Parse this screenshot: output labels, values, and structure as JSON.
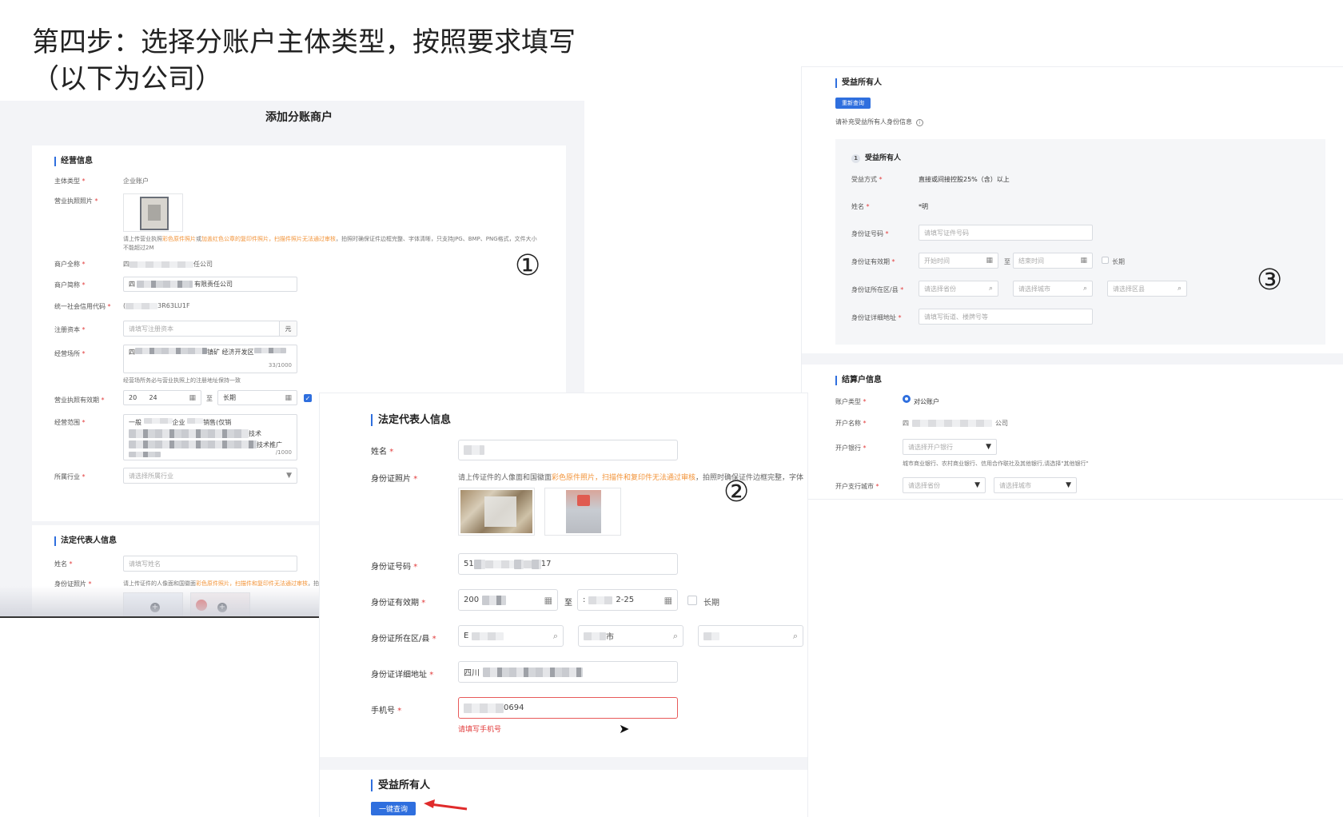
{
  "headline": {
    "line1": "第四步：选择分账户主体类型，按照要求填写",
    "line2": "（以下为公司）"
  },
  "panel1": {
    "title": "添加分账商户",
    "circle": "①",
    "business_section": "经营信息",
    "subject_type_label": "主体类型",
    "subject_type_value": "企业账户",
    "license_photo_label": "营业执照照片",
    "license_hint_a": "请上传营业执照",
    "license_hint_b": "彩色原件照片",
    "license_hint_c": "或",
    "license_hint_d": "加盖红色公章的复印件照片，扫描件照片无法通过审核",
    "license_hint_e": "，拍照时确保证件边框完整、字体清晰，只支持JPG、BMP、PNG格式，文件大小",
    "license_hint_f": "不能超过2M",
    "full_name_label": "商户全称",
    "full_name_a": "四",
    "full_name_b": "任公司",
    "short_name_label": "商户简称",
    "short_name_a": "四",
    "short_name_b": "有限责任公司",
    "credit_code_label": "统一社会信用代码",
    "credit_code_a": "(",
    "credit_code_b": "3R63LU1F",
    "capital_label": "注册资本",
    "capital_placeholder": "请填写注册资本",
    "capital_unit": "元",
    "place_label": "经营场所",
    "place_a": "四",
    "place_b": "镇矿",
    "place_c": "经济开发",
    "place_d": "区",
    "place_e": "",
    "place_count": "33/1000",
    "place_hint": "经营场所务必与营业执照上的注册地址保持一致",
    "validity_label": "营业执照有效期",
    "validity_start_a": "20",
    "validity_start_b": "24",
    "validity_to": "至",
    "validity_end": "长期",
    "scope_label": "经营范围",
    "scope_a": "一般",
    "scope_b": "企业",
    "scope_c": "销售(仅销",
    "scope_d": "技术",
    "scope_e": "技",
    "scope_f": "术推广",
    "scope_count": "/1000",
    "industry_label": "所属行业",
    "industry_placeholder": "请选择所属行业",
    "legal_section": "法定代表人信息",
    "name_label": "姓名",
    "name_placeholder": "请填写姓名",
    "id_photo_label": "身份证照片",
    "id_hint_a": "请上传证件的人像面和国徽面",
    "id_hint_b": "彩色原件照片",
    "id_hint_c": "，扫描件和复印件无法通过审核",
    "id_hint_d": "，拍"
  },
  "panel2": {
    "circle": "②",
    "section": "法定代表人信息",
    "name_label": "姓名",
    "id_photo_label": "身份证照片",
    "id_hint_a": "请上传证件的人像面和国徽面",
    "id_hint_b": "彩色原件照片",
    "id_hint_c": "，扫描件和复印件无法通过审核",
    "id_hint_d": "，拍照时确保证件边框完整，字体",
    "id_number_label": "身份证号码",
    "id_number_a": "51",
    "id_number_b": "17",
    "id_validity_label": "身份证有效期",
    "id_validity_start": "200",
    "id_validity_to": "至",
    "id_validity_end_a": ":",
    "id_validity_end_b": "2-25",
    "long_term": "长期",
    "id_region_label": "身份证所在区/县",
    "region_1": "E",
    "region_2": "市",
    "region_3": "",
    "id_address_label": "身份证详细地址",
    "id_address": "四川",
    "phone_label": "手机号",
    "phone_value": "0694",
    "phone_error": "请填写手机号",
    "beneficiary_section": "受益所有人",
    "one_click_button": "一键查询"
  },
  "panel3": {
    "circle": "③",
    "beneficiary_section": "受益所有人",
    "requery_button": "重新查询",
    "supplement_hint": "请补充受益所有人身份信息",
    "step_number": "1",
    "step_title": "受益所有人",
    "benefit_mode_label": "受益方式",
    "benefit_mode_value": "直接或间接控股25%（含）以上",
    "name_label": "姓名",
    "name_value": "*明",
    "id_number_label": "身份证号码",
    "id_number_placeholder": "请填写证件号码",
    "id_validity_label": "身份证有效期",
    "start_placeholder": "开始时间",
    "to": "至",
    "end_placeholder": "结束时间",
    "long_term": "长期",
    "region_label": "身份证所在区/县",
    "province_placeholder": "请选择省份",
    "city_placeholder": "请选择城市",
    "district_placeholder": "请选择区县",
    "address_label": "身份证详细地址",
    "address_placeholder": "请填写街道、楼牌号等",
    "settlement_section": "结算户信息",
    "account_type_label": "账户类型",
    "account_type_value": "对公账户",
    "account_name_label": "开户名称",
    "account_name_a": "四",
    "account_name_b": "公司",
    "bank_label": "开户银行",
    "bank_placeholder": "请选择开户银行",
    "bank_hint": "城市商业银行、农村商业银行、信用合作联社及其他银行,请选择\"其他银行\"",
    "branch_city_label": "开户支行城市",
    "branch_province_placeholder": "请选择省份",
    "branch_city_placeholder": "请选择城市"
  },
  "colors": {
    "accent": "#2f6fde",
    "required": "#e23c3c",
    "warning_text": "#f29338",
    "arrow": "#e02b2b"
  }
}
